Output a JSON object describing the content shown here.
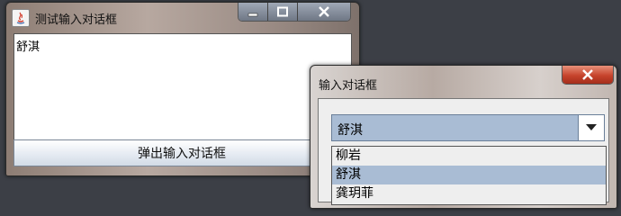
{
  "main_window": {
    "title": "测试输入对话框",
    "text_area": {
      "value": "舒淇"
    },
    "popup_button_label": "弹出输入对话框",
    "controls": {
      "minimize_icon": "minimize-icon",
      "maximize_icon": "maximize-icon",
      "close_icon": "close-icon"
    }
  },
  "dialog": {
    "title": "输入对话框",
    "combo": {
      "selected": "舒淇"
    },
    "options": [
      "柳岩",
      "舒淇",
      "龚玥菲"
    ],
    "selected_index": 1
  },
  "colors": {
    "desktop": "#3c3f46",
    "selection": "#a9bcd4",
    "close_red": "#c6432c"
  }
}
